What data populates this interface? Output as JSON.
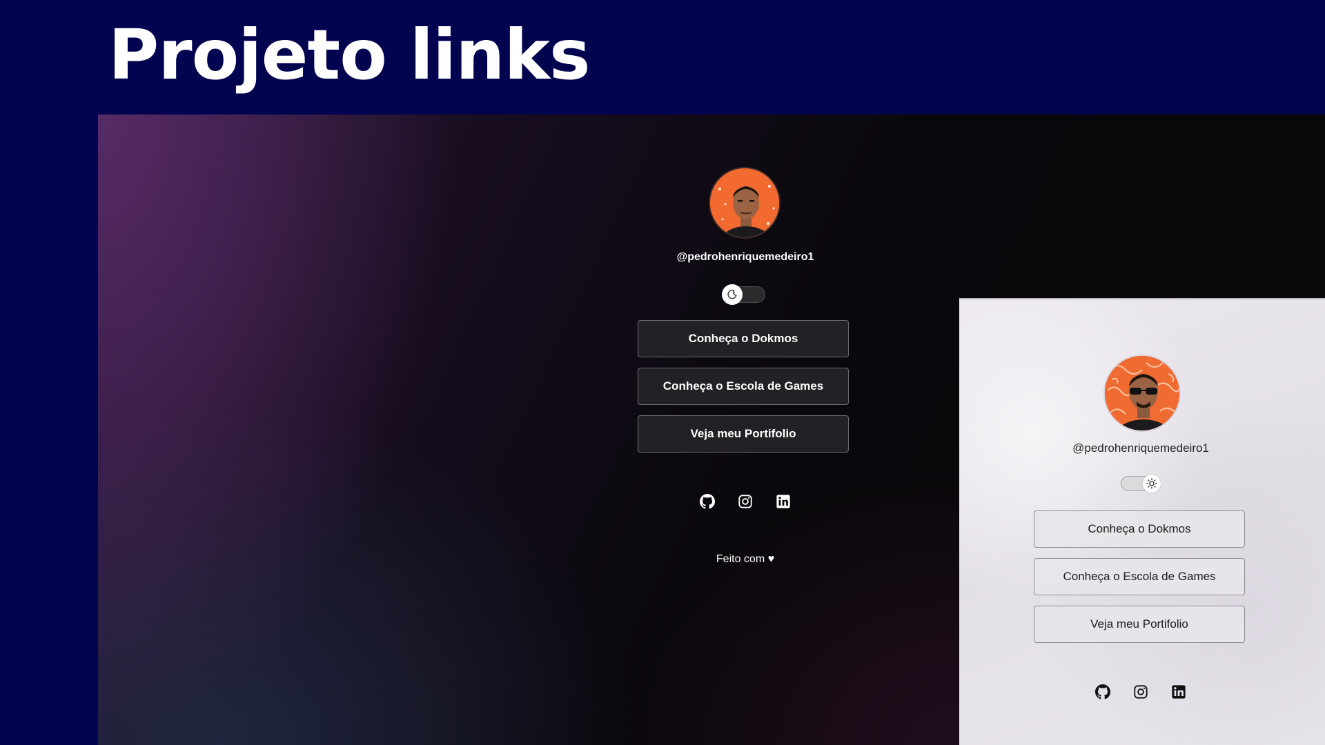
{
  "slide": {
    "title": "Projeto links"
  },
  "dark_view": {
    "username": "@pedrohenriquemedeiro1",
    "theme_toggle": "dark",
    "links": [
      {
        "label": "Conheça o Dokmos"
      },
      {
        "label": "Conheça o Escola de Games"
      },
      {
        "label": "Veja meu Portifolio"
      }
    ],
    "socials": [
      {
        "icon": "github-icon"
      },
      {
        "icon": "instagram-icon"
      },
      {
        "icon": "linkedin-icon"
      }
    ],
    "footer": "Feito com ♥"
  },
  "light_view": {
    "username": "@pedrohenriquemedeiro1",
    "theme_toggle": "light",
    "links": [
      {
        "label": "Conheça o Dokmos"
      },
      {
        "label": "Conheça o Escola de Games"
      },
      {
        "label": "Veja meu Portifolio"
      }
    ],
    "socials": [
      {
        "icon": "github-icon"
      },
      {
        "icon": "instagram-icon"
      },
      {
        "icon": "linkedin-icon"
      }
    ]
  },
  "colors": {
    "slide_background": "#02044f",
    "accent_orange": "#f26a30",
    "dark_button_bg": "#262428",
    "light_button_bg": "#e8e6ea"
  }
}
